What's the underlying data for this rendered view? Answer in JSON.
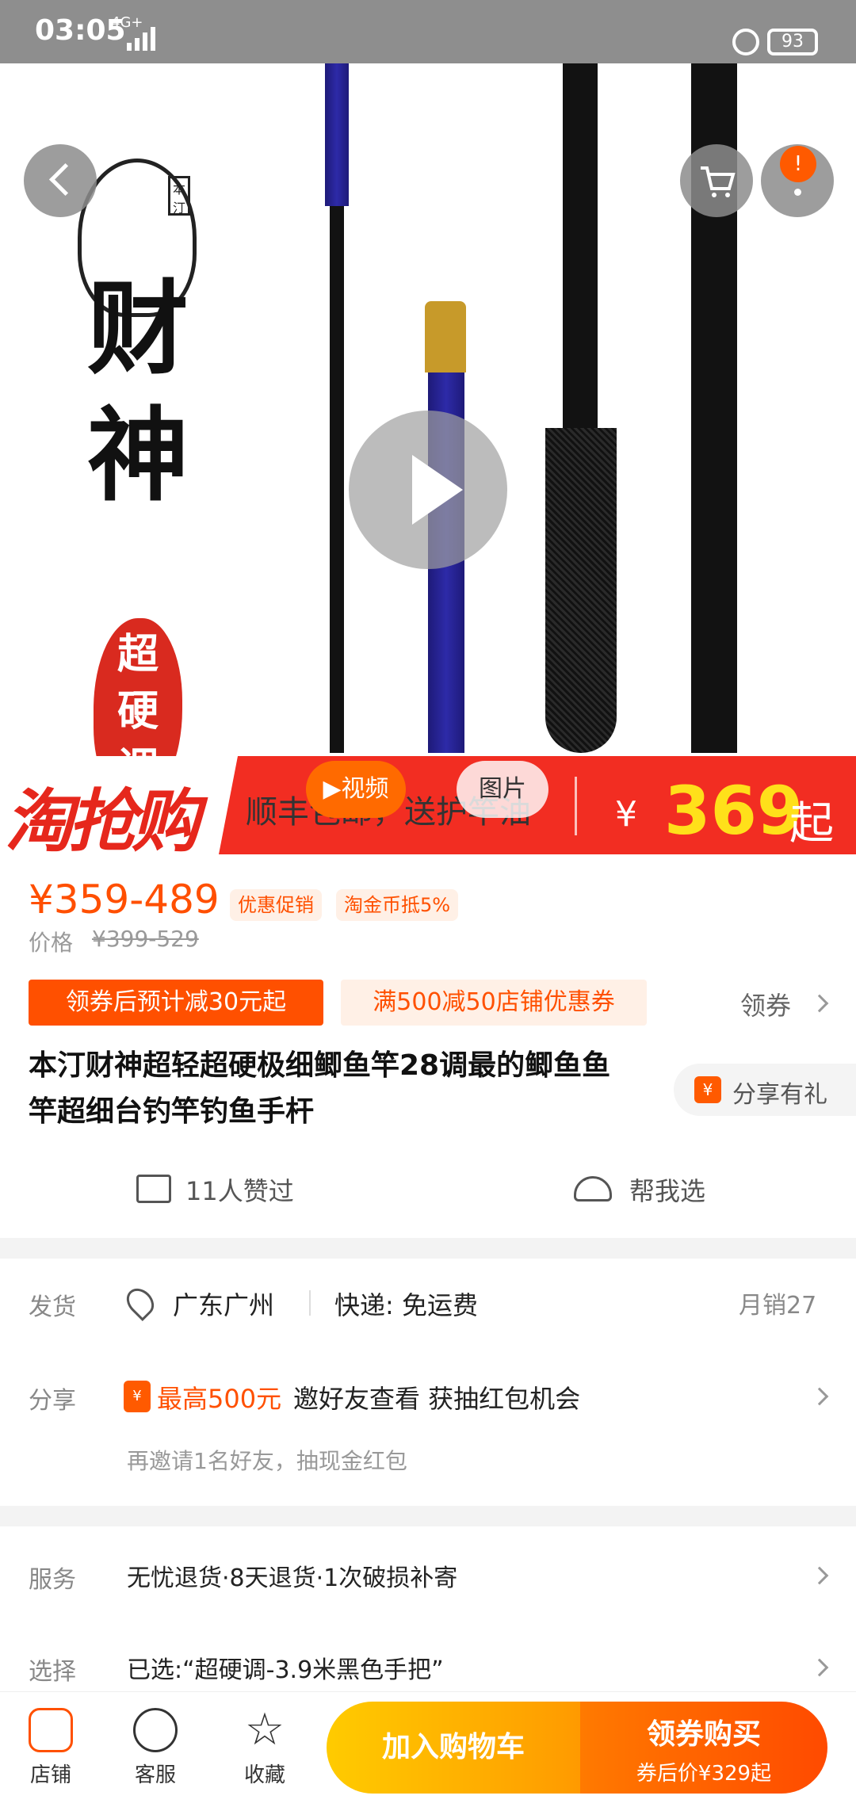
{
  "status_bar": {
    "time": "03:05",
    "network": "4G+",
    "battery": "93"
  },
  "hero": {
    "brand_chars": [
      "财",
      "神"
    ],
    "stamp_chars": [
      "超",
      "硬",
      "调"
    ],
    "seal_text": "本汀",
    "media_tabs": {
      "video": "▶视频",
      "image": "图片"
    },
    "cart_badge": "!"
  },
  "promo": {
    "logo": "淘抢购",
    "notice": "顺丰包邮，送护竿油",
    "currency": "¥",
    "price": "369",
    "suffix": "起"
  },
  "price": {
    "range": "¥359-489",
    "tags": [
      "优惠促销",
      "淘金币抵5%"
    ],
    "original_label": "价格",
    "original_range": "¥399-529"
  },
  "coupons": {
    "estimated": "领券后预计减30元起",
    "store_coupon": "满500减50店铺优惠券",
    "get_label": "领券"
  },
  "product": {
    "title": "本汀财神超轻超硬极细鲫鱼竿28调最的鲫鱼鱼竿超细台钓竿钓鱼手杆",
    "share_gift": "分享有礼",
    "likes": "11人赞过",
    "help_choose": "帮我选"
  },
  "shipping": {
    "label": "发货",
    "location": "广东广州",
    "express": "快递: 免运费",
    "monthly_sales": "月销27"
  },
  "share": {
    "label": "分享",
    "highlight": "最高500元",
    "text": "邀好友查看 获抽红包机会",
    "sub": "再邀请1名好友，抽现金红包"
  },
  "service": {
    "label": "服务",
    "text": "无忧退货·8天退货·1次破损补寄"
  },
  "selection": {
    "label": "选择",
    "text": "已选:“超硬调-3.9米黑色手把”"
  },
  "bottom_bar": {
    "store": "店铺",
    "customer_service": "客服",
    "favorite": "收藏",
    "add_to_cart": "加入购物车",
    "buy_with_coupon": "领券购买",
    "after_coupon_price": "券后价¥329起"
  },
  "colors": {
    "accent": "#ff5000",
    "promo_red": "#f22d22",
    "price_yellow": "#ffe01a"
  }
}
